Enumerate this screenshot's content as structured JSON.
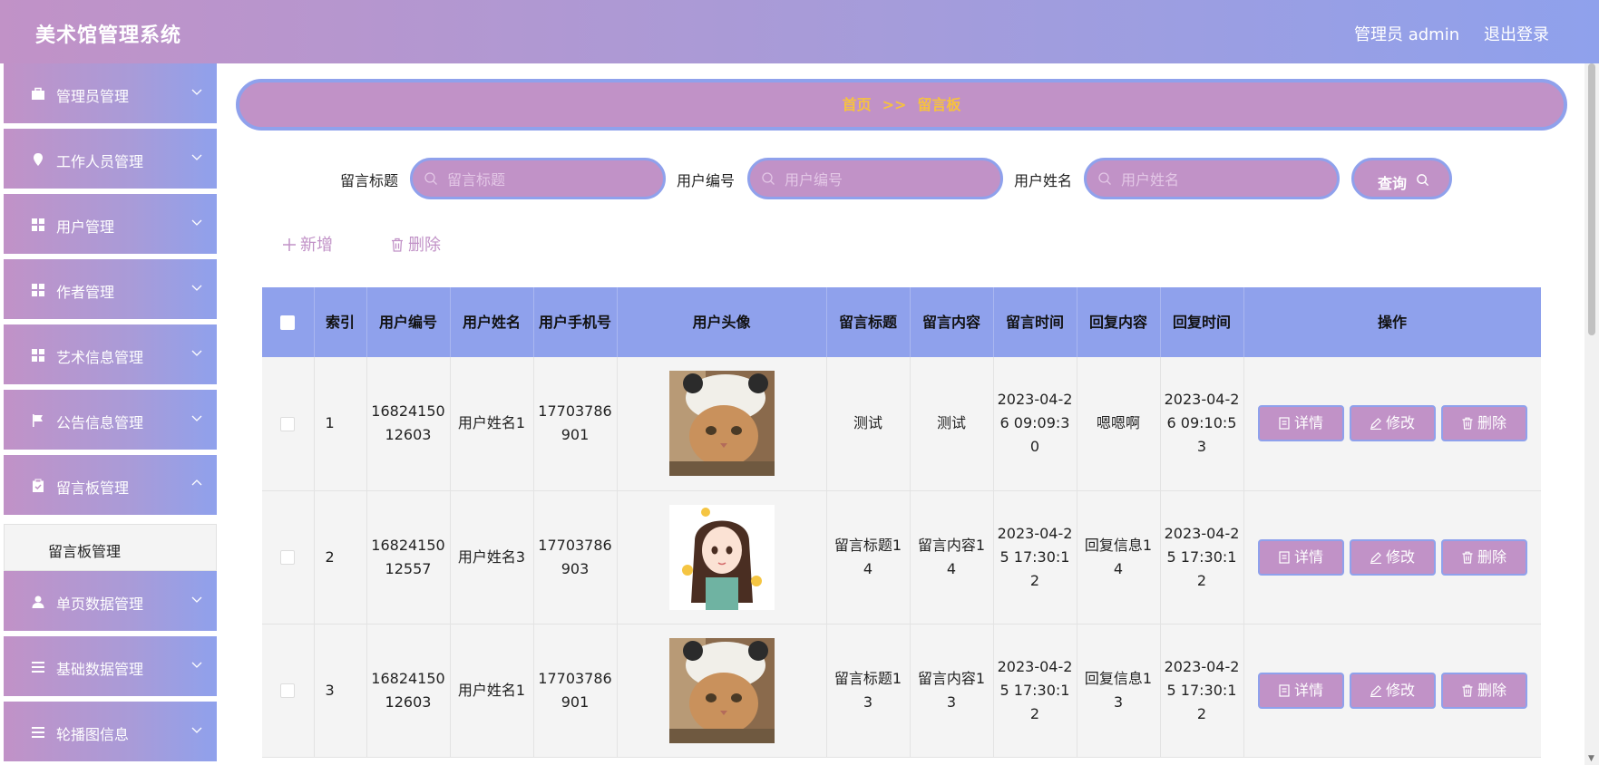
{
  "header": {
    "title": "美术馆管理系统",
    "admin_label": "管理员 admin",
    "logout_label": "退出登录"
  },
  "sidebar": {
    "items": [
      {
        "label": "管理员管理",
        "icon": "briefcase-icon"
      },
      {
        "label": "工作人员管理",
        "icon": "location-pin-icon"
      },
      {
        "label": "用户管理",
        "icon": "grid-icon"
      },
      {
        "label": "作者管理",
        "icon": "grid-icon"
      },
      {
        "label": "艺术信息管理",
        "icon": "grid-icon"
      },
      {
        "label": "公告信息管理",
        "icon": "flag-icon"
      },
      {
        "label": "留言板管理",
        "icon": "clipboard-icon"
      },
      {
        "label": "单页数据管理",
        "icon": "user-icon"
      },
      {
        "label": "基础数据管理",
        "icon": "list-icon"
      },
      {
        "label": "轮播图信息",
        "icon": "list-icon"
      }
    ],
    "active_submenu": "留言板管理"
  },
  "breadcrumb": {
    "home": "首页",
    "separator": ">>",
    "current": "留言板"
  },
  "search": {
    "fields": [
      {
        "label": "留言标题",
        "placeholder": "留言标题"
      },
      {
        "label": "用户编号",
        "placeholder": "用户编号"
      },
      {
        "label": "用户姓名",
        "placeholder": "用户姓名"
      }
    ],
    "query_label": "查询"
  },
  "actions": {
    "add_label": "新增",
    "delete_label": "删除"
  },
  "table": {
    "columns": [
      "索引",
      "用户编号",
      "用户姓名",
      "用户手机号",
      "用户头像",
      "留言标题",
      "留言内容",
      "留言时间",
      "回复内容",
      "回复时间",
      "操作"
    ],
    "rows": [
      {
        "index": "1",
        "user_no": "1682415012603",
        "user_name": "用户姓名1",
        "phone": "17703786901",
        "avatar": "cat-avatar",
        "title": "测试",
        "content": "测试",
        "time": "2023-04-26 09:09:30",
        "reply": "嗯嗯啊",
        "reply_time": "2023-04-26 09:10:53"
      },
      {
        "index": "2",
        "user_no": "1682415012557",
        "user_name": "用户姓名3",
        "phone": "17703786903",
        "avatar": "girl-avatar",
        "title": "留言标题14",
        "content": "留言内容14",
        "time": "2023-04-25 17:30:12",
        "reply": "回复信息14",
        "reply_time": "2023-04-25 17:30:12"
      },
      {
        "index": "3",
        "user_no": "1682415012603",
        "user_name": "用户姓名1",
        "phone": "17703786901",
        "avatar": "cat-avatar",
        "title": "留言标题13",
        "content": "留言内容13",
        "time": "2023-04-25 17:30:12",
        "reply": "回复信息13",
        "reply_time": "2023-04-25 17:30:12"
      }
    ],
    "op_labels": {
      "detail": "详情",
      "edit": "修改",
      "delete": "删除"
    }
  },
  "colors": {
    "accent_pink": "#c192c7",
    "accent_blue": "#8fa1ec",
    "breadcrumb_text": "#f6c23e"
  }
}
